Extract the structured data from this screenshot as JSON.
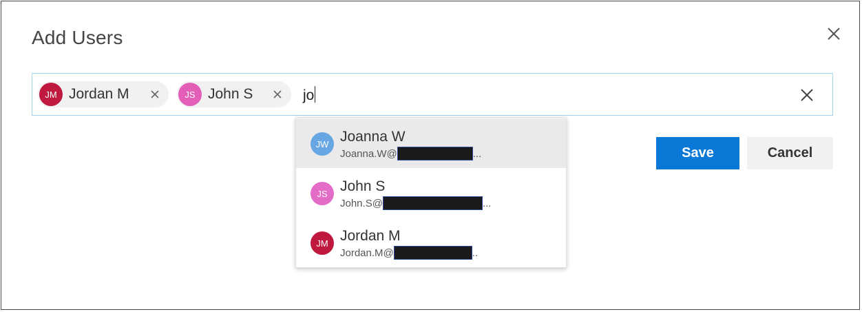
{
  "dialog": {
    "title": "Add Users",
    "close_icon": "close-icon",
    "colors": {
      "accent": "#0A78D7",
      "border_focus": "#9FD3EE"
    }
  },
  "picker": {
    "selected": [
      {
        "initials": "JM",
        "name": "Jordan M",
        "color": "#C0193F",
        "remove_icon": "close-icon"
      },
      {
        "initials": "JS",
        "name": "John S",
        "color": "#E35FB7",
        "remove_icon": "close-icon"
      }
    ],
    "query": "jo",
    "clear_icon": "close-icon"
  },
  "suggestions": [
    {
      "initials": "JW",
      "name": "Joanna W",
      "email_prefix": "Joanna.W@",
      "email_suffix": "...",
      "color": "#67A5E3",
      "highlighted": true
    },
    {
      "initials": "JS",
      "name": "John S",
      "email_prefix": "John.S@",
      "email_suffix": "...",
      "color": "#E36CC6",
      "highlighted": false
    },
    {
      "initials": "JM",
      "name": "Jordan M",
      "email_prefix": "Jordan.M@",
      "email_suffix": "..",
      "color": "#C0193F",
      "highlighted": false
    }
  ],
  "actions": {
    "save_label": "Save",
    "cancel_label": "Cancel"
  }
}
